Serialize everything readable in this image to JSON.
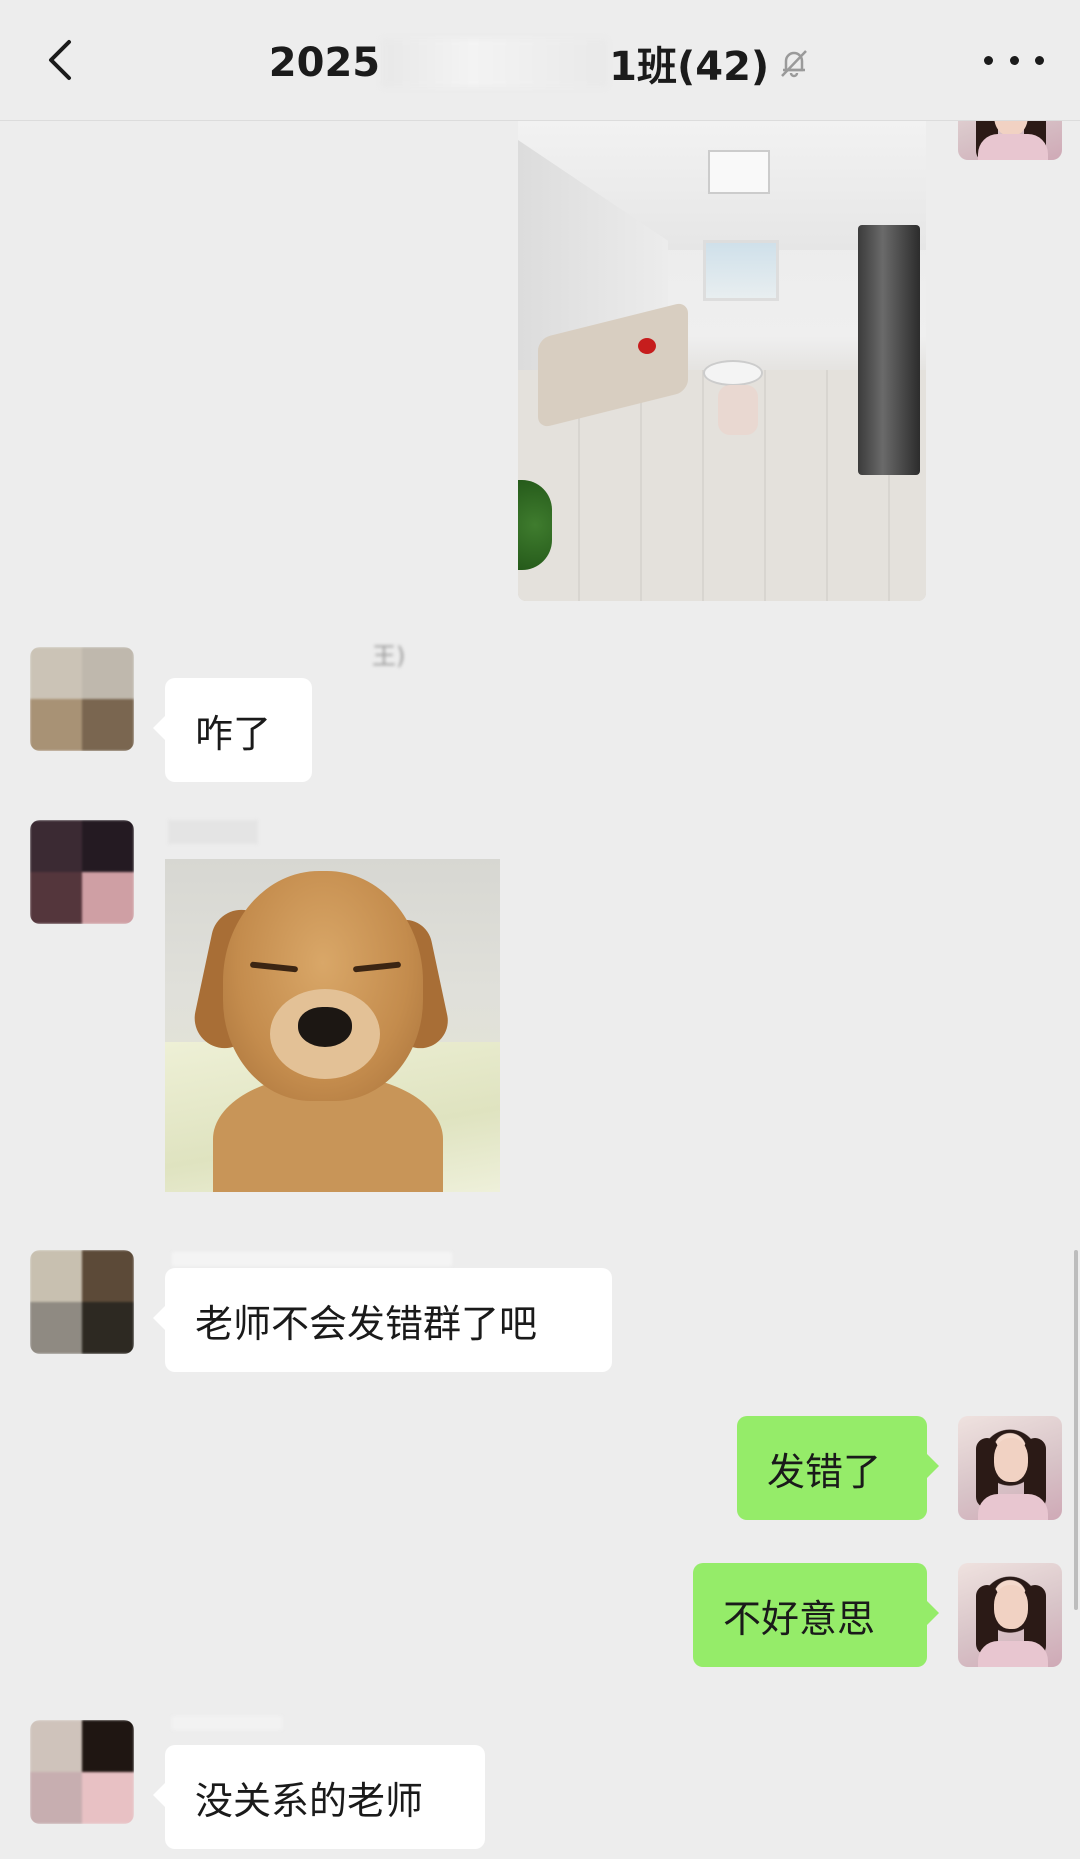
{
  "header": {
    "title_prefix": "2025",
    "title_suffix": "1班(42)",
    "back_icon": "chevron-left-icon",
    "mute_icon": "bell-off-icon",
    "more_icon": "more-dots-icon"
  },
  "messages": [
    {
      "side": "right",
      "type": "image",
      "content": "living-room-photo"
    },
    {
      "side": "left",
      "type": "text",
      "sender": "王)",
      "text": "咋了"
    },
    {
      "side": "left",
      "type": "image",
      "sender": "",
      "content": "puppy-photo"
    },
    {
      "side": "left",
      "type": "text",
      "sender": "",
      "text": "老师不会发错群了吧"
    },
    {
      "side": "right",
      "type": "text",
      "text": "发错了"
    },
    {
      "side": "right",
      "type": "text",
      "text": "不好意思"
    },
    {
      "side": "left",
      "type": "text",
      "sender": "",
      "text": "没关系的老师"
    }
  ],
  "colors": {
    "background": "#ededed",
    "bubble_mine": "#95ec69",
    "bubble_other": "#ffffff"
  }
}
